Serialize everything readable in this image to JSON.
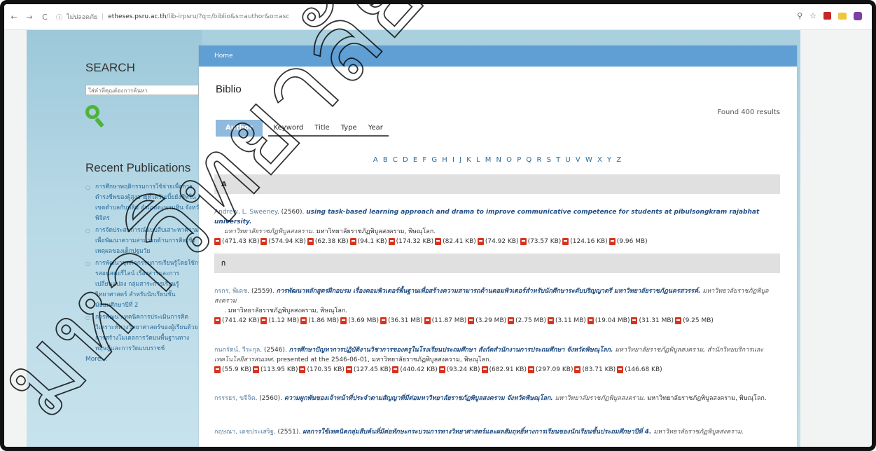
{
  "browser": {
    "back": "←",
    "forward": "→",
    "reload": "C",
    "security_label": "ไม่ปลอดภัย",
    "domain": "etheses.psru.ac.th",
    "path": "/lib-irpsru/?q=/biblio&s=author&o=asc"
  },
  "sidebar": {
    "search_heading": "SEARCH",
    "search_placeholder": "ใส่คำที่คุณต้องการค้นหา",
    "recent_heading": "Recent Publications",
    "publications": [
      "การศึกษาพฤติกรรมการใช้จ่ายเพื่อการดำรงชีพของผู้สูงอายุที่ได้รับเบี้ยยังชีพในเขตตำบลกับหลิม อำเภอตะพานหิน จังหวัดพิจิตร",
      "การจัดประสบการณ์แบบสืบเสาะหาความรู้เพื่อพัฒนาความสามารถด้านการคิดเชิงเหตุผลของเด็กปฐมวัย",
      "การพัฒนาชุดกิจกรรมการเรียนรู้โดยใช้การสอนสตอรี่ไลน์ เรื่องสารและการเปลี่ยนแปลง กลุ่มสาระการเรียนรู้วิทยาศาสตร์ สำหรับนักเรียนชั้นมัธยมศึกษาปีที่ 2",
      "การพัฒนาเทคนิคการประเมินการคิดวิเคราะห์ทางวิทยาศาสตร์ของผู้เรียนด้วยการสร้างโมเดลการวัดบนพื้นฐานทางทฤษฎีและการวัดแบบราซช์"
    ],
    "more": "More..."
  },
  "main": {
    "breadcrumb": "Home",
    "title": "Biblio",
    "found": "Found 400 results",
    "tabs": [
      "Author",
      "Keyword",
      "Title",
      "Type",
      "Year"
    ],
    "letters": "A B C D E F G H I J K L M N O P Q R S T U V W X Y Z",
    "sections": [
      "A",
      "ก"
    ],
    "entries": [
      {
        "author": "Andrew, L. Sweeney",
        "year": ". (2560). ",
        "title": "using task-based learning approach and drama to improve communicative competence for students at pibulsongkram rajabhat university.",
        "publisher": "มหาวิทยาลัยราชภัฏพิบูลสงคราม",
        "place": ". มหาวิทยาลัยราชภัฏพิบูลสงคราม, พิษณุโลก.",
        "files": [
          "(471.43 KB)",
          "(574.94 KB)",
          "(62.38 KB)",
          "(94.1 KB)",
          "(174.32 KB)",
          "(82.41 KB)",
          "(74.92 KB)",
          "(73.57 KB)",
          "(124.16 KB)",
          "(9.96 MB)"
        ]
      },
      {
        "author": "กรกร, พิเดช",
        "year": ". (2559). ",
        "title": "การพัฒนาหลักสูตรฝึกอบรม เรื่องคอมพิวเตอร์พื้นฐานเพื่อสร้างความสามารถด้านคอมพิวเตอร์สำหรับนักศึกษาระดับปริญญาตรี มหาวิทยาลัยราชภัฏนครสวรรค์.",
        "publisher": "มหาวิทยาลัยราชภัฏพิบูลสงคราม",
        "place": ". มหาวิทยาลัยราชภัฏพิบูลสงคราม, พิษณุโลก.",
        "files": [
          "(741.42 KB)",
          "(1.12 MB)",
          "(1.86 MB)",
          "(3.69 MB)",
          "(36.31 MB)",
          "(11.87 MB)",
          "(3.29 MB)",
          "(2.75 MB)",
          "(3.11 MB)",
          "(19.04 MB)",
          "(31.31 MB)",
          "(9.25 MB)"
        ]
      },
      {
        "author": "กนกรัตน์, วีระกุล",
        "year": ". (2546). ",
        "title": "การศึกษาปัญหาการปฏิบัติงานวิชาการของครูในโรงเรียนประถมศึกษา สังกัดสำนักงานการประถมศึกษา จังหวัดพิษณุโลก.",
        "publisher": "มหาวิทยาลัยราชภัฏพิบูลสงคราม, สำนักวิทยบริการและเทคโนโลยีสารสนเทศ.",
        "place": " presented at the 2546-06-01, มหาวิทยาลัยราชภัฏพิบูลสงคราม, พิษณุโลก.",
        "files": [
          "(55.9 KB)",
          "(113.95 KB)",
          "(170.35 KB)",
          "(127.45 KB)",
          "(440.42 KB)",
          "(93.24 KB)",
          "(682.91 KB)",
          "(297.09 KB)",
          "(83.71 KB)",
          "(146.68 KB)"
        ]
      },
      {
        "author": "กรรรธร, ขจีจิต",
        "year": ". (2560). ",
        "title": "ความผูกพันของเจ้าหน้าที่ประจำตามสัญญาที่มีต่อมหาวิทยาลัยราชภัฏพิบูลสงคราม จังหวัดพิษณุโลก.",
        "publisher": "มหาวิทยาลัยราชภัฏพิบูลสงคราม",
        "place": ". มหาวิทยาลัยราชภัฏพิบูลสงคราม, พิษณุโลก.",
        "files": []
      },
      {
        "author": "กฤษณา, เดชประเสริฐ",
        "year": ". (2551). ",
        "title": "ผลการใช้เทคนิคกลุ่มสืบค้นที่มีต่อทักษะกระบวนการทางวิทยาศาสตร์และผลสัมฤทธิ์ทางการเรียนของนักเรียนชั้นประถมศึกษาปีที่ 4.",
        "publisher": "มหาวิทยาลัยราชภัฏพิบูลสงคราม.",
        "place": "",
        "files": []
      }
    ]
  },
  "watermark": {
    "text": "มหาวิทยาลัยราชภัฏพิบูลสงคราม",
    "color": "#000000"
  },
  "colors": {
    "crumb_bar": "#5f9fd3",
    "active_tab": "#8fb9dd",
    "link": "#2b6c99",
    "pdf": "#d7341f"
  }
}
